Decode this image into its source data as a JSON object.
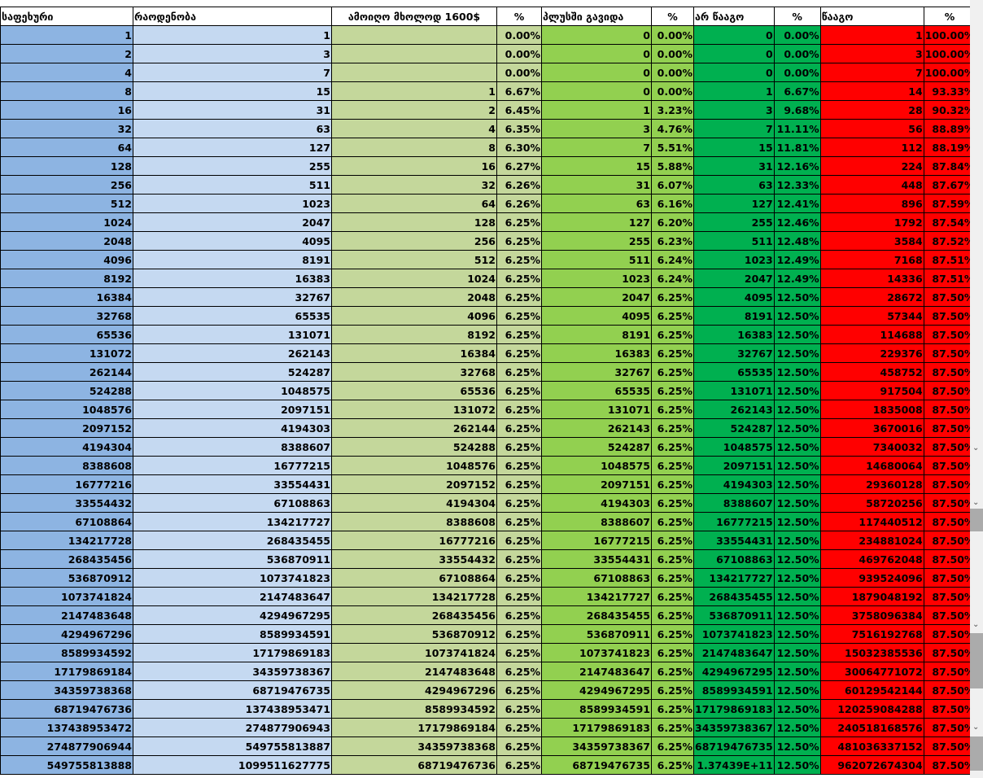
{
  "headers": [
    "საფეხური",
    "რაოდენობა",
    "ამოიღო მხოლოდ 1600$",
    "%",
    "პლუსში გავიდა",
    "%",
    "არ წააგო",
    "%",
    "წააგო",
    "%"
  ],
  "colors": {
    "step": "#8DB4E2",
    "count": "#C5D9F1",
    "only1600": "#C4D79B",
    "plus": "#92D050",
    "notlost": "#00B050",
    "lost": "#FF0000"
  },
  "rows": [
    [
      "1",
      "1",
      "",
      "0.00%",
      "0",
      "0.00%",
      "0",
      "0.00%",
      "1",
      "100.00%"
    ],
    [
      "2",
      "3",
      "",
      "0.00%",
      "0",
      "0.00%",
      "0",
      "0.00%",
      "3",
      "100.00%"
    ],
    [
      "4",
      "7",
      "",
      "0.00%",
      "0",
      "0.00%",
      "0",
      "0.00%",
      "7",
      "100.00%"
    ],
    [
      "8",
      "15",
      "1",
      "6.67%",
      "0",
      "0.00%",
      "1",
      "6.67%",
      "14",
      "93.33%"
    ],
    [
      "16",
      "31",
      "2",
      "6.45%",
      "1",
      "3.23%",
      "3",
      "9.68%",
      "28",
      "90.32%"
    ],
    [
      "32",
      "63",
      "4",
      "6.35%",
      "3",
      "4.76%",
      "7",
      "11.11%",
      "56",
      "88.89%"
    ],
    [
      "64",
      "127",
      "8",
      "6.30%",
      "7",
      "5.51%",
      "15",
      "11.81%",
      "112",
      "88.19%"
    ],
    [
      "128",
      "255",
      "16",
      "6.27%",
      "15",
      "5.88%",
      "31",
      "12.16%",
      "224",
      "87.84%"
    ],
    [
      "256",
      "511",
      "32",
      "6.26%",
      "31",
      "6.07%",
      "63",
      "12.33%",
      "448",
      "87.67%"
    ],
    [
      "512",
      "1023",
      "64",
      "6.26%",
      "63",
      "6.16%",
      "127",
      "12.41%",
      "896",
      "87.59%"
    ],
    [
      "1024",
      "2047",
      "128",
      "6.25%",
      "127",
      "6.20%",
      "255",
      "12.46%",
      "1792",
      "87.54%"
    ],
    [
      "2048",
      "4095",
      "256",
      "6.25%",
      "255",
      "6.23%",
      "511",
      "12.48%",
      "3584",
      "87.52%"
    ],
    [
      "4096",
      "8191",
      "512",
      "6.25%",
      "511",
      "6.24%",
      "1023",
      "12.49%",
      "7168",
      "87.51%"
    ],
    [
      "8192",
      "16383",
      "1024",
      "6.25%",
      "1023",
      "6.24%",
      "2047",
      "12.49%",
      "14336",
      "87.51%"
    ],
    [
      "16384",
      "32767",
      "2048",
      "6.25%",
      "2047",
      "6.25%",
      "4095",
      "12.50%",
      "28672",
      "87.50%"
    ],
    [
      "32768",
      "65535",
      "4096",
      "6.25%",
      "4095",
      "6.25%",
      "8191",
      "12.50%",
      "57344",
      "87.50%"
    ],
    [
      "65536",
      "131071",
      "8192",
      "6.25%",
      "8191",
      "6.25%",
      "16383",
      "12.50%",
      "114688",
      "87.50%"
    ],
    [
      "131072",
      "262143",
      "16384",
      "6.25%",
      "16383",
      "6.25%",
      "32767",
      "12.50%",
      "229376",
      "87.50%"
    ],
    [
      "262144",
      "524287",
      "32768",
      "6.25%",
      "32767",
      "6.25%",
      "65535",
      "12.50%",
      "458752",
      "87.50%"
    ],
    [
      "524288",
      "1048575",
      "65536",
      "6.25%",
      "65535",
      "6.25%",
      "131071",
      "12.50%",
      "917504",
      "87.50%"
    ],
    [
      "1048576",
      "2097151",
      "131072",
      "6.25%",
      "131071",
      "6.25%",
      "262143",
      "12.50%",
      "1835008",
      "87.50%"
    ],
    [
      "2097152",
      "4194303",
      "262144",
      "6.25%",
      "262143",
      "6.25%",
      "524287",
      "12.50%",
      "3670016",
      "87.50%"
    ],
    [
      "4194304",
      "8388607",
      "524288",
      "6.25%",
      "524287",
      "6.25%",
      "1048575",
      "12.50%",
      "7340032",
      "87.50%"
    ],
    [
      "8388608",
      "16777215",
      "1048576",
      "6.25%",
      "1048575",
      "6.25%",
      "2097151",
      "12.50%",
      "14680064",
      "87.50%"
    ],
    [
      "16777216",
      "33554431",
      "2097152",
      "6.25%",
      "2097151",
      "6.25%",
      "4194303",
      "12.50%",
      "29360128",
      "87.50%"
    ],
    [
      "33554432",
      "67108863",
      "4194304",
      "6.25%",
      "4194303",
      "6.25%",
      "8388607",
      "12.50%",
      "58720256",
      "87.50%"
    ],
    [
      "67108864",
      "134217727",
      "8388608",
      "6.25%",
      "8388607",
      "6.25%",
      "16777215",
      "12.50%",
      "117440512",
      "87.50%"
    ],
    [
      "134217728",
      "268435455",
      "16777216",
      "6.25%",
      "16777215",
      "6.25%",
      "33554431",
      "12.50%",
      "234881024",
      "87.50%"
    ],
    [
      "268435456",
      "536870911",
      "33554432",
      "6.25%",
      "33554431",
      "6.25%",
      "67108863",
      "12.50%",
      "469762048",
      "87.50%"
    ],
    [
      "536870912",
      "1073741823",
      "67108864",
      "6.25%",
      "67108863",
      "6.25%",
      "134217727",
      "12.50%",
      "939524096",
      "87.50%"
    ],
    [
      "1073741824",
      "2147483647",
      "134217728",
      "6.25%",
      "134217727",
      "6.25%",
      "268435455",
      "12.50%",
      "1879048192",
      "87.50%"
    ],
    [
      "2147483648",
      "4294967295",
      "268435456",
      "6.25%",
      "268435455",
      "6.25%",
      "536870911",
      "12.50%",
      "3758096384",
      "87.50%"
    ],
    [
      "4294967296",
      "8589934591",
      "536870912",
      "6.25%",
      "536870911",
      "6.25%",
      "1073741823",
      "12.50%",
      "7516192768",
      "87.50%"
    ],
    [
      "8589934592",
      "17179869183",
      "1073741824",
      "6.25%",
      "1073741823",
      "6.25%",
      "2147483647",
      "12.50%",
      "15032385536",
      "87.50%"
    ],
    [
      "17179869184",
      "34359738367",
      "2147483648",
      "6.25%",
      "2147483647",
      "6.25%",
      "4294967295",
      "12.50%",
      "30064771072",
      "87.50%"
    ],
    [
      "34359738368",
      "68719476735",
      "4294967296",
      "6.25%",
      "4294967295",
      "6.25%",
      "8589934591",
      "12.50%",
      "60129542144",
      "87.50%"
    ],
    [
      "68719476736",
      "137438953471",
      "8589934592",
      "6.25%",
      "8589934591",
      "6.25%",
      "17179869183",
      "12.50%",
      "120259084288",
      "87.50%"
    ],
    [
      "137438953472",
      "274877906943",
      "17179869184",
      "6.25%",
      "17179869183",
      "6.25%",
      "34359738367",
      "12.50%",
      "240518168576",
      "87.50%"
    ],
    [
      "274877906944",
      "549755813887",
      "34359738368",
      "6.25%",
      "34359738367",
      "6.25%",
      "68719476735",
      "12.50%",
      "481036337152",
      "87.50%"
    ],
    [
      "549755813888",
      "1099511627775",
      "68719476736",
      "6.25%",
      "68719476735",
      "6.25%",
      "1.37439E+11",
      "12.50%",
      "962072674304",
      "87.50%"
    ]
  ]
}
